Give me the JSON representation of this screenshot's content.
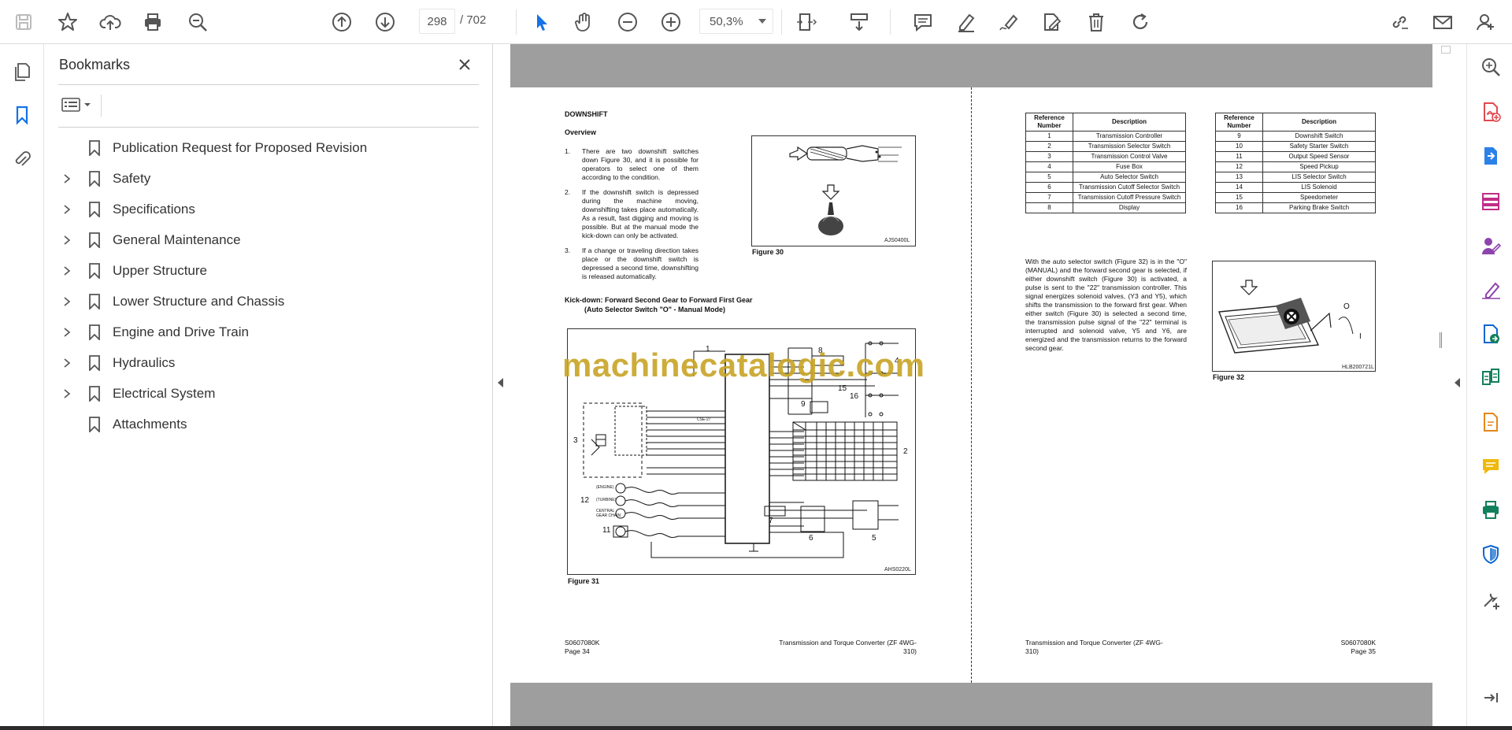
{
  "toolbar": {
    "page_current": "298",
    "page_total": "/ 702",
    "zoom": "50,3%"
  },
  "bookmarks": {
    "title": "Bookmarks",
    "items": [
      {
        "label": "Publication Request for Proposed Revision",
        "expandable": false
      },
      {
        "label": "Safety",
        "expandable": true
      },
      {
        "label": "Specifications",
        "expandable": true
      },
      {
        "label": "General Maintenance",
        "expandable": true
      },
      {
        "label": "Upper Structure",
        "expandable": true
      },
      {
        "label": "Lower Structure and Chassis",
        "expandable": true
      },
      {
        "label": "Engine and Drive Train",
        "expandable": true
      },
      {
        "label": "Hydraulics",
        "expandable": true
      },
      {
        "label": "Electrical System",
        "expandable": true
      },
      {
        "label": "Attachments",
        "expandable": false
      }
    ]
  },
  "watermark": "machinecatalogic.com",
  "left_page": {
    "heading": "DOWNSHIFT",
    "subheading": "Overview",
    "list": [
      {
        "num": "1.",
        "text": "There are two downshift switches down Figure 30, and it is possible for operators to select one of them according to the condition."
      },
      {
        "num": "2.",
        "text": "If the downshift switch is depressed during the machine moving, downshifting takes place automatically. As a result, fast digging and moving is possible. But at the manual mode the kick-down can only be activated."
      },
      {
        "num": "3.",
        "text": "If a change or traveling direction takes place or the downshift switch is depressed a second time, downshifting is released automatically."
      }
    ],
    "kickdown_line1": "Kick-down: Forward Second Gear to Forward First Gear",
    "kickdown_line2": "(Auto Selector Switch \"O\" - Manual Mode)",
    "fig30_caption": "Figure 30",
    "fig30_code": "AJS0400L",
    "fig31_caption": "Figure 31",
    "fig31_code": "AHS0220L",
    "footer_left_1": "S0607080K",
    "footer_left_2": "Page 34",
    "footer_right_1": "Transmission and Torque Converter (ZF 4WG-",
    "footer_right_2": "310)"
  },
  "right_page": {
    "table_headers": [
      "Reference Number",
      "Description"
    ],
    "table1": [
      [
        "1",
        "Transmission Controller"
      ],
      [
        "2",
        "Transmission Selector Switch"
      ],
      [
        "3",
        "Transmission Control Valve"
      ],
      [
        "4",
        "Fuse Box"
      ],
      [
        "5",
        "Auto Selector Switch"
      ],
      [
        "6",
        "Transmission Cutoff Selector Switch"
      ],
      [
        "7",
        "Transmission Cutoff Pressure Switch"
      ],
      [
        "8",
        "Display"
      ]
    ],
    "table2": [
      [
        "9",
        "Downshift Switch"
      ],
      [
        "10",
        "Safety Starter Switch"
      ],
      [
        "11",
        "Output Speed Sensor"
      ],
      [
        "12",
        "Speed Pickup"
      ],
      [
        "13",
        "LIS Selector Switch"
      ],
      [
        "14",
        "LIS Solenoid"
      ],
      [
        "15",
        "Speedometer"
      ],
      [
        "16",
        "Parking Brake Switch"
      ]
    ],
    "paragraph": "With the auto selector switch (Figure 32) is in the \"O\" (MANUAL) and the forward second gear is selected, if either downshift switch (Figure 30) is activated, a pulse is sent to the \"22\" transmission controller. This signal energizes solenoid valves, (Y3 and Y5), which shifts the transmission to the forward first gear. When either switch (Figure 30) is selected a second time, the transmission pulse signal of the \"22\" terminal is interrupted and solenoid valve, Y5 and Y6, are energized and the transmission returns to the forward second gear.",
    "fig32_caption": "Figure 32",
    "fig32_code": "HLB200721L",
    "footer_left_1": "Transmission and Torque Converter (ZF 4WG-",
    "footer_left_2": "310)",
    "footer_right_1": "S0607080K",
    "footer_right_2": "Page 35"
  },
  "diagram_labels": {
    "n1": "1",
    "n2": "2",
    "n3": "3",
    "n4": "4",
    "n5": "5",
    "n6": "6",
    "n7": "7",
    "n8": "8",
    "n9": "9",
    "n11": "11",
    "n12": "12",
    "n15": "15",
    "n16": "16",
    "ctrl": "CSE-27",
    "engine": "(ENGINE)",
    "turbine": "(TURBINE)",
    "central": "CENTRAL",
    "gear": "GEAR CHAIN",
    "o": "O",
    "i": "I"
  }
}
